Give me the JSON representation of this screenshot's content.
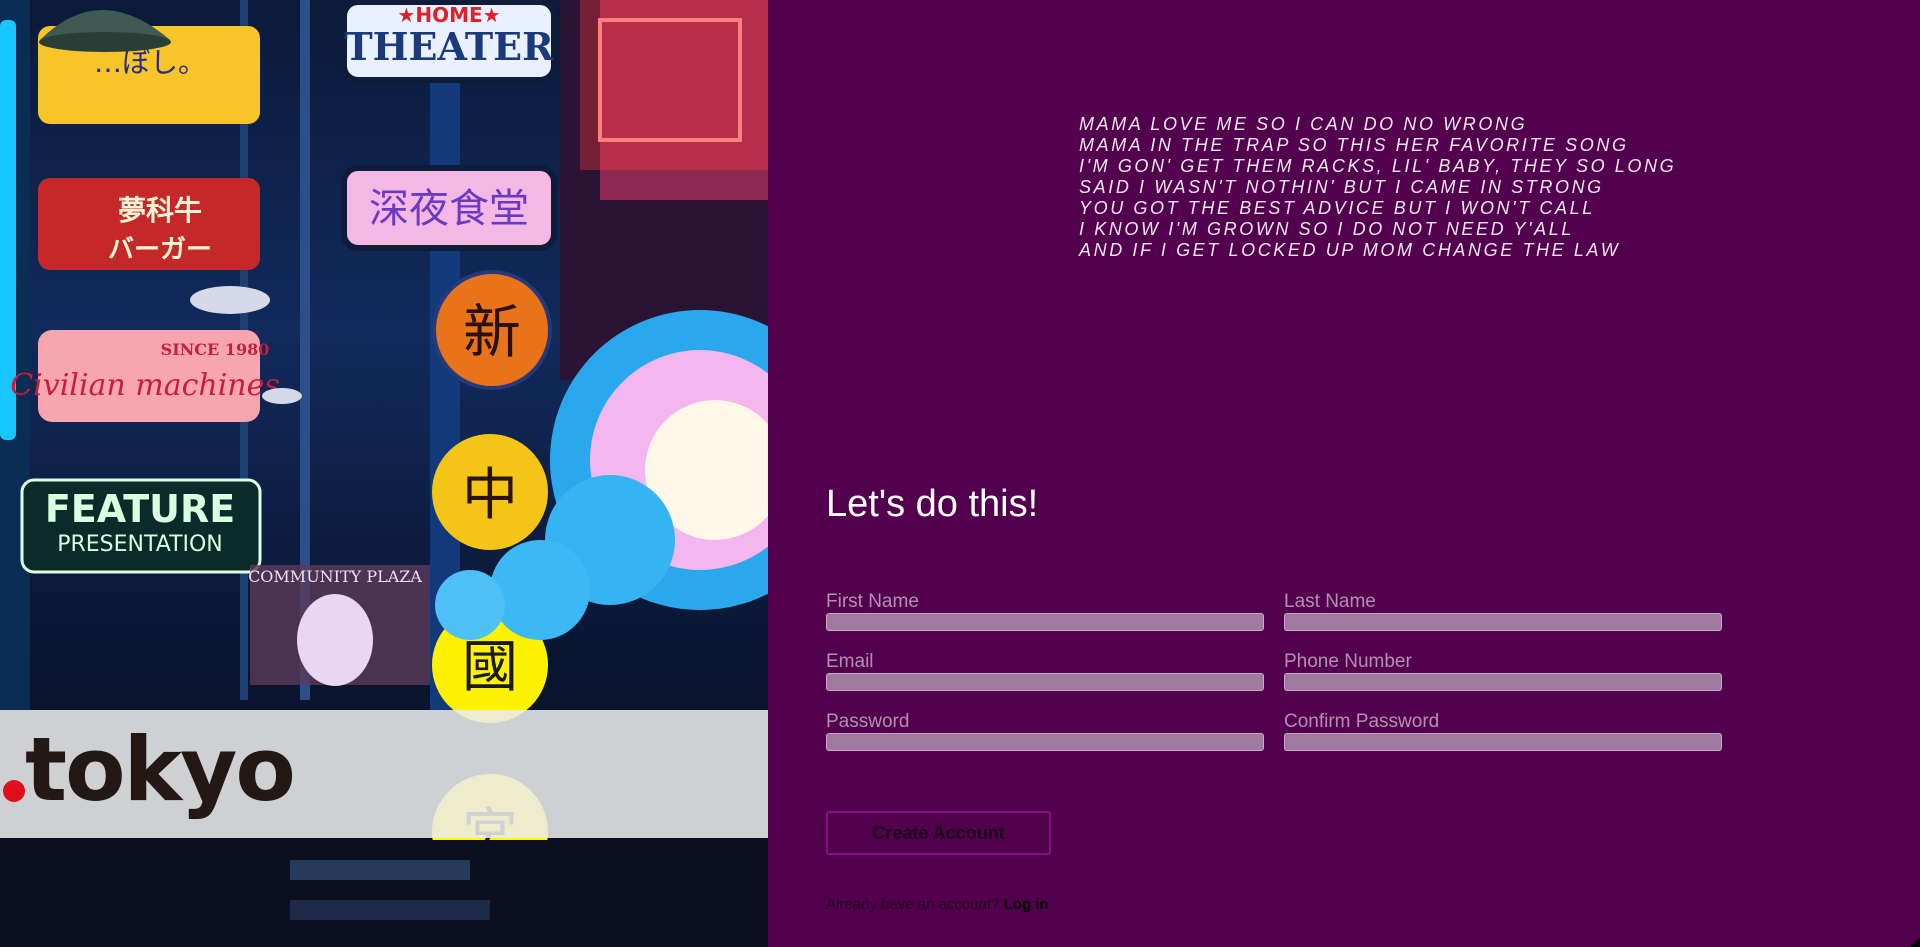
{
  "hero": {
    "logo_text": "tokyo",
    "background_image": "neon street signs",
    "dot_color": "#e0101a"
  },
  "lyrics": [
    "MAMA LOVE ME SO I CAN DO NO WRONG",
    "MAMA IN THE TRAP SO THIS HER FAVORITE SONG",
    "I'M GON' GET THEM RACKS, LIL' BABY, THEY SO LONG",
    "SAID I WASN'T NOTHIN' BUT I CAME IN STRONG",
    "YOU GOT THE BEST ADVICE BUT I WON'T CALL",
    "I KNOW I'M GROWN SO I DO NOT NEED Y'ALL",
    "AND IF I GET LOCKED UP MOM CHANGE THE LAW"
  ],
  "form": {
    "heading": "Let's do this!",
    "fields": {
      "first_name": {
        "label": "First Name",
        "value": ""
      },
      "last_name": {
        "label": "Last Name",
        "value": ""
      },
      "email": {
        "label": "Email",
        "value": ""
      },
      "phone": {
        "label": "Phone Number",
        "value": ""
      },
      "password": {
        "label": "Password",
        "value": ""
      },
      "confirm_password": {
        "label": "Confirm Password",
        "value": ""
      }
    },
    "submit_label": "Create Account",
    "login_prompt": "Already have an account?",
    "login_link": "Log in"
  },
  "colors": {
    "background": "#52004d",
    "input_fill": "#a07a9e",
    "label": "#b48fb2",
    "button_border": "#8a0f86"
  }
}
